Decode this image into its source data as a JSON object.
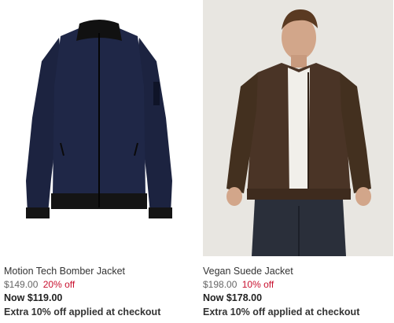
{
  "products": [
    {
      "name": "Motion Tech Bomber Jacket",
      "original_price": "$149.00",
      "discount": "20% off",
      "now_price": "Now $119.00",
      "promo": "Extra 10% off applied at checkout",
      "image": "navy-bomber-jacket-image"
    },
    {
      "name": "Vegan Suede Jacket",
      "original_price": "$198.00",
      "discount": "10% off",
      "now_price": "Now $178.00",
      "promo": "Extra 10% off applied at checkout",
      "image": "brown-suede-jacket-model-image"
    }
  ],
  "colors": {
    "discount": "#c8102e",
    "bomber": "#1c2340",
    "suede": "#4a3426",
    "photo_bg": "#e8e6e1"
  }
}
